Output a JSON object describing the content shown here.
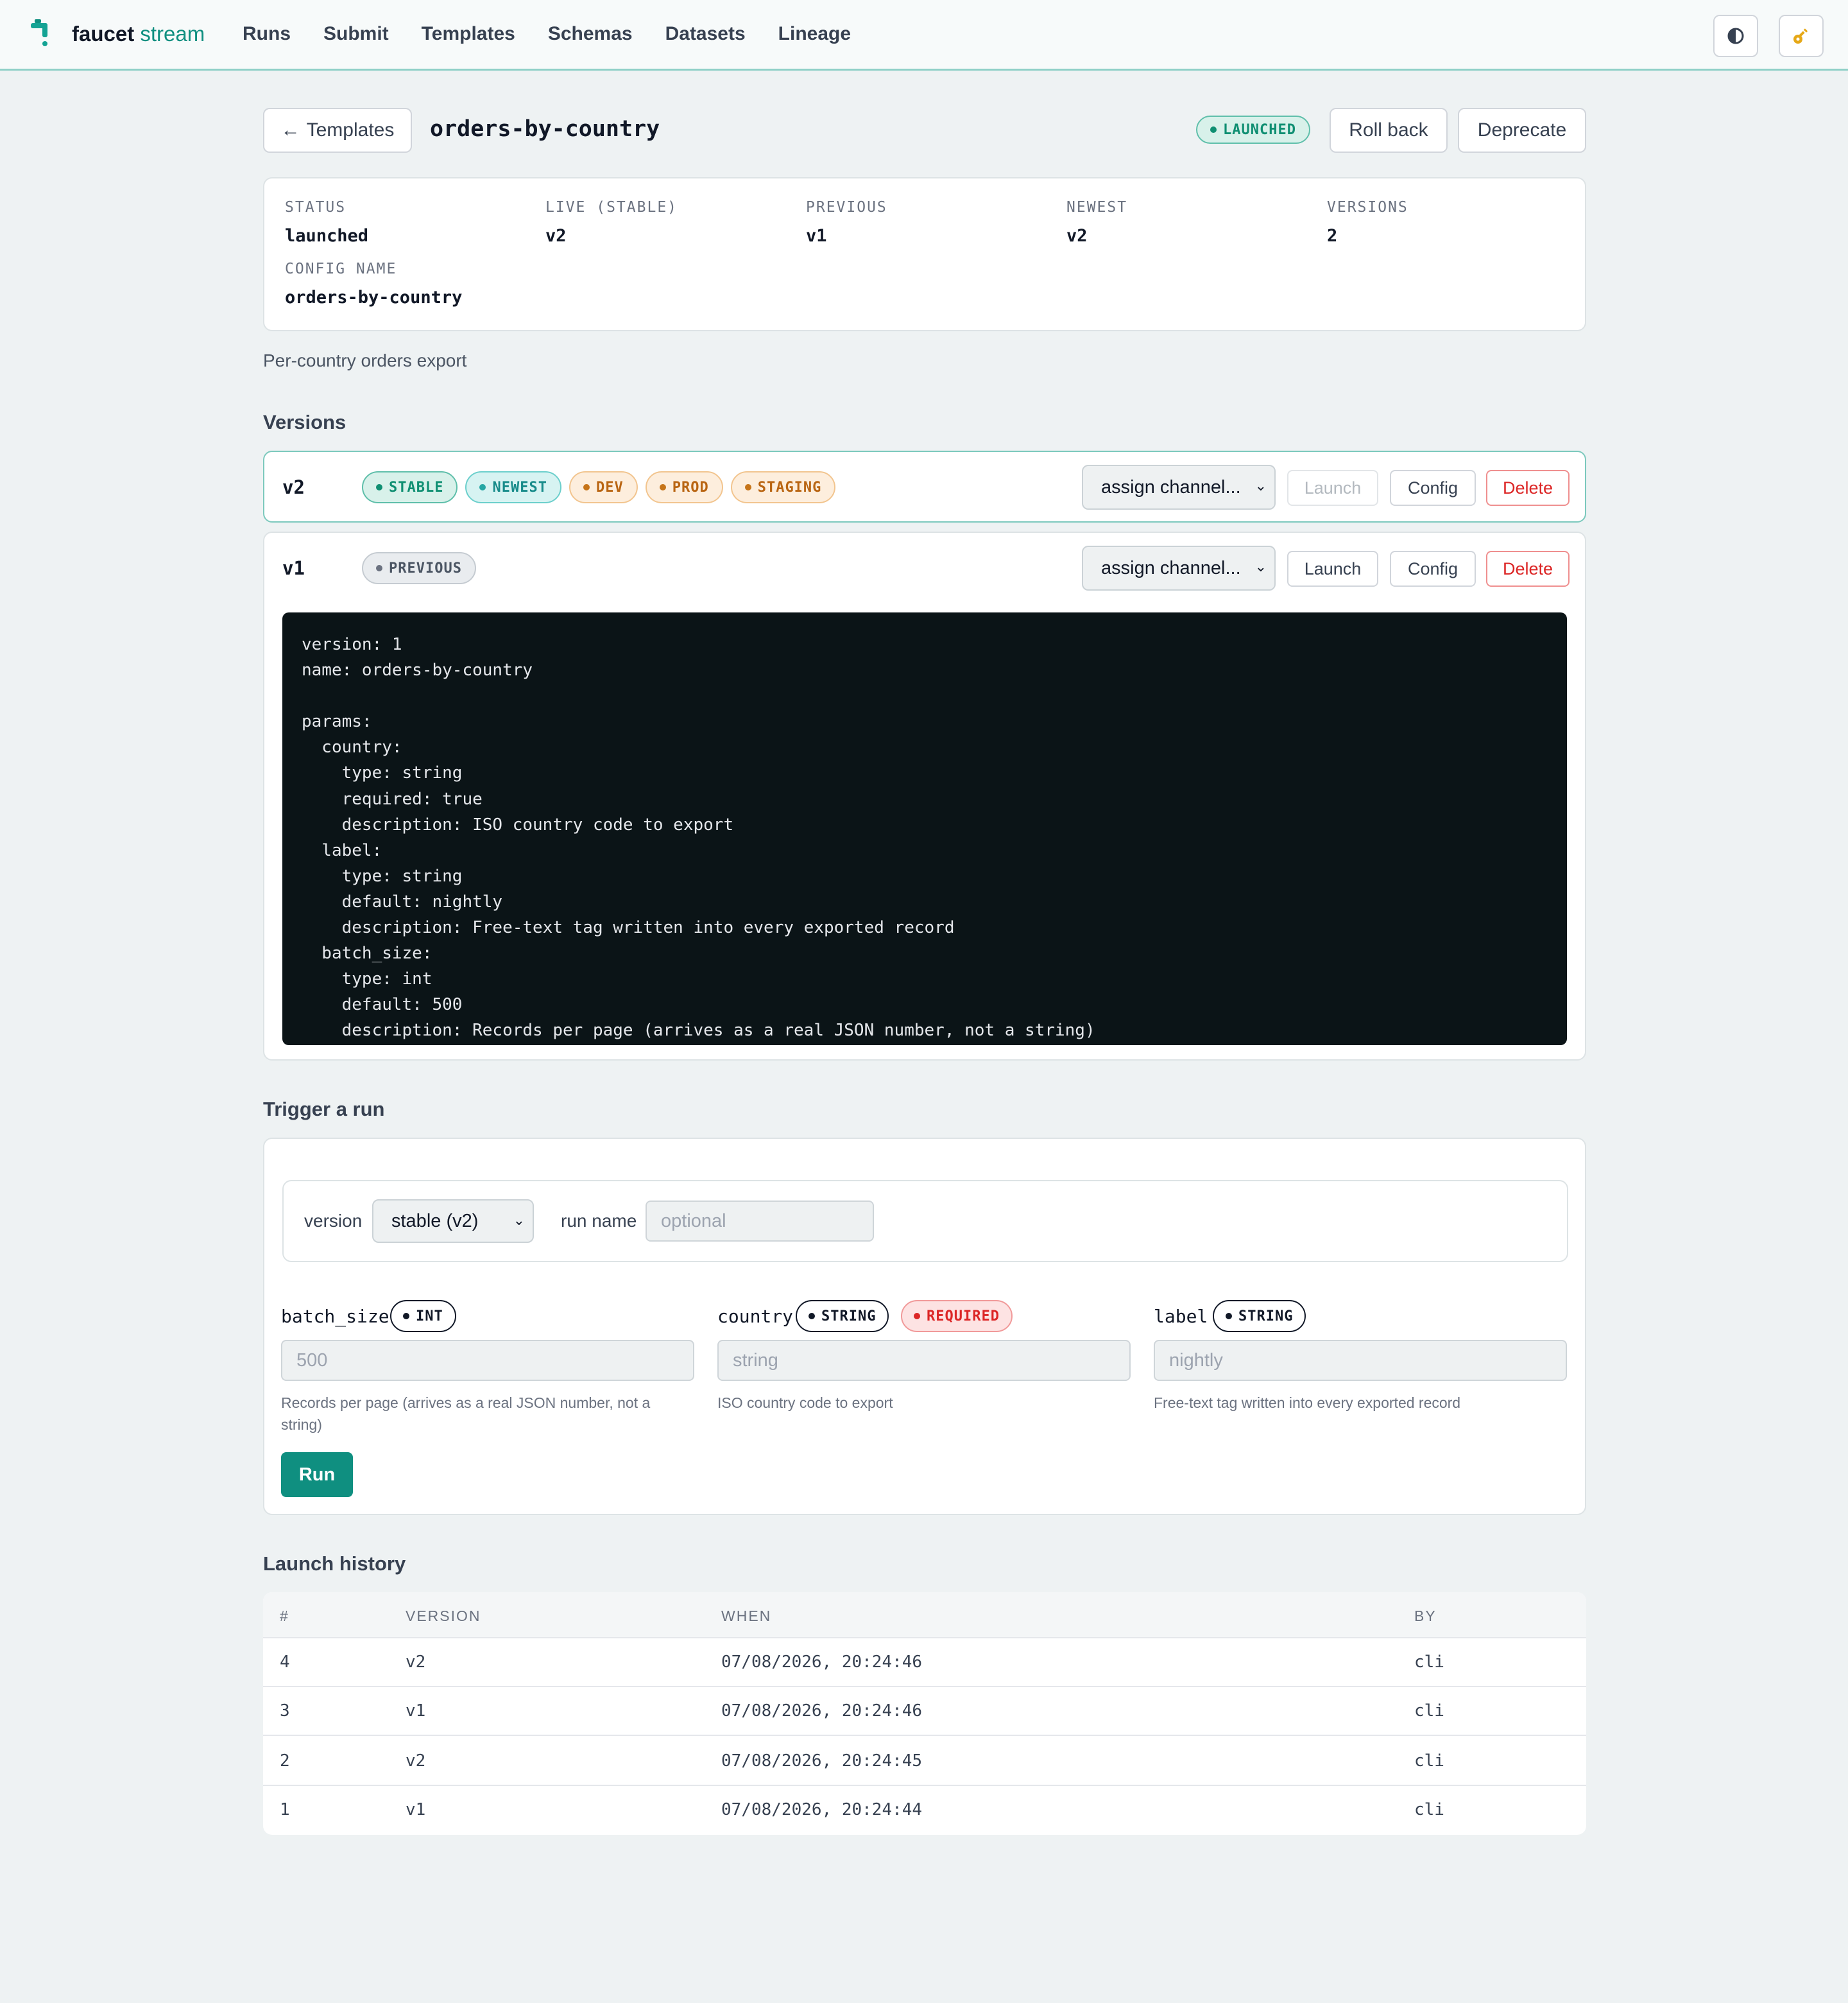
{
  "brand": {
    "name_bold": "faucet",
    "name_light": " stream"
  },
  "nav": [
    "Runs",
    "Submit",
    "Templates",
    "Schemas",
    "Datasets",
    "Lineage"
  ],
  "header": {
    "back_label": "Templates",
    "title": "orders-by-country",
    "status_badge": "LAUNCHED",
    "rollback_label": "Roll back",
    "deprecate_label": "Deprecate"
  },
  "summary": {
    "status_label": "STATUS",
    "status_value": "launched",
    "live_label": "LIVE (STABLE)",
    "live_value": "v2",
    "previous_label": "PREVIOUS",
    "previous_value": "v1",
    "newest_label": "NEWEST",
    "newest_value": "v2",
    "versions_label": "VERSIONS",
    "versions_value": "2",
    "config_label": "CONFIG NAME",
    "config_value": "orders-by-country"
  },
  "description": "Per-country orders export",
  "versions_heading": "Versions",
  "versions": [
    {
      "name": "v2",
      "pills": [
        "STABLE",
        "NEWEST",
        "DEV",
        "PROD",
        "STAGING"
      ],
      "assign_label": "assign channel...",
      "launch_label": "Launch",
      "config_label": "Config",
      "delete_label": "Delete"
    },
    {
      "name": "v1",
      "pills": [
        "PREVIOUS"
      ],
      "assign_label": "assign channel...",
      "launch_label": "Launch",
      "config_label": "Config",
      "delete_label": "Delete",
      "config_yaml": "version: 1\nname: orders-by-country\n\nparams:\n  country:\n    type: string\n    required: true\n    description: ISO country code to export\n  label:\n    type: string\n    default: nightly\n    description: Free-text tag written into every exported record\n  batch_size:\n    type: int\n    default: 500\n    description: Records per page (arrives as a real JSON number, not a string)"
    }
  ],
  "trigger": {
    "heading": "Trigger a run",
    "version_label": "version",
    "version_value": "stable (v2)",
    "run_name_label": "run name",
    "run_name_placeholder": "optional",
    "params": [
      {
        "name": "batch_size",
        "type": "INT",
        "placeholder": "500",
        "help": "Records per page (arrives as a real JSON number, not a string)"
      },
      {
        "name": "country",
        "type": "STRING",
        "required": "REQUIRED",
        "placeholder": "string",
        "help": "ISO country code to export"
      },
      {
        "name": "label",
        "type": "STRING",
        "placeholder": "nightly",
        "help": "Free-text tag written into every exported record"
      }
    ],
    "run_label": "Run"
  },
  "history": {
    "heading": "Launch history",
    "columns": [
      "#",
      "VERSION",
      "WHEN",
      "BY"
    ],
    "rows": [
      [
        "4",
        "v2",
        "07/08/2026, 20:24:46",
        "cli"
      ],
      [
        "3",
        "v1",
        "07/08/2026, 20:24:46",
        "cli"
      ],
      [
        "2",
        "v2",
        "07/08/2026, 20:24:45",
        "cli"
      ],
      [
        "1",
        "v1",
        "07/08/2026, 20:24:44",
        "cli"
      ]
    ]
  },
  "icons": {
    "theme": "half-circle-icon",
    "key": "key-icon",
    "back": "arrow-left-icon",
    "logo": "faucet-logo-icon"
  },
  "colors": {
    "accent": "#0f8f80",
    "danger": "#dc2626",
    "channel": "#b96512"
  }
}
